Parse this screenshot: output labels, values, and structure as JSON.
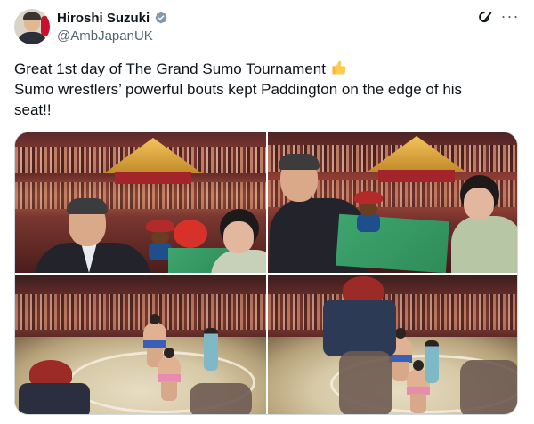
{
  "author": {
    "display_name": "Hiroshi Suzuki",
    "handle": "@AmbJapanUK",
    "verified": true
  },
  "header_icons": [
    "grok-icon",
    "more-icon"
  ],
  "more_label": "···",
  "tweet": {
    "line1": "Great 1st day of The Grand Sumo Tournament",
    "line1_emoji": "thumbs-up-icon",
    "line2": "Sumo wrestlers’ powerful bouts kept Paddington on the edge of his",
    "line3": "seat!!"
  },
  "media": {
    "count": 4,
    "photos": [
      {
        "description_name": "photo-ambassador-with-paddington-1"
      },
      {
        "description_name": "photo-ambassador-with-paddington-2"
      },
      {
        "description_name": "photo-sumo-bout-1"
      },
      {
        "description_name": "photo-sumo-bout-2"
      }
    ]
  },
  "colors": {
    "text": "#0f1419",
    "secondary_text": "#536471",
    "verified": "#829aab",
    "border": "#cfd9de"
  }
}
